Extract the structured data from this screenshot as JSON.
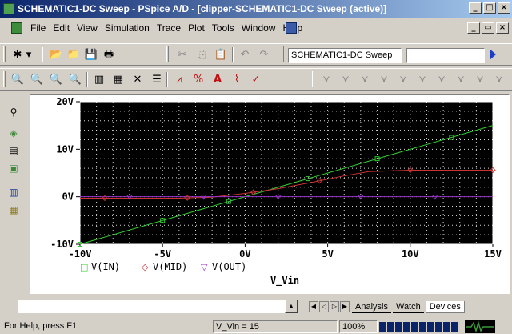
{
  "window": {
    "title": "SCHEMATIC1-DC Sweep - PSpice A/D - [clipper-SCHEMATIC1-DC Sweep (active)]",
    "min_glyph": "_",
    "max_glyph": "□",
    "close_glyph": "×",
    "restore_glyph": "▭"
  },
  "menu": {
    "items": [
      "File",
      "Edit",
      "View",
      "Simulation",
      "Trace",
      "Plot",
      "Tools",
      "Window",
      "Help"
    ]
  },
  "toolbar1": {
    "profile_value": "SCHEMATIC1-DC Sweep",
    "search_value": ""
  },
  "icons": {
    "new": "✱",
    "dropdown": "▾",
    "open": "📂",
    "open2": "📁",
    "save": "💾",
    "print": "🖶",
    "cut": "✂",
    "copy": "⎘",
    "paste": "📋",
    "undo": "↶",
    "redo": "↷",
    "zoom_in": "🔍",
    "zoom_out": "🔍",
    "zoom_area": "🔍",
    "zoom_fit": "🔍",
    "log_x": "▥",
    "fourier": "▦",
    "performance": "✕",
    "toggle": "☰",
    "add_trace": "⩘",
    "trace_math": "%",
    "ab": "A",
    "cursor": "⌇",
    "cursor2": "✓",
    "mark": "⋎",
    "dock1": "⚲",
    "dock2": "◈",
    "dock3": "▤",
    "dock4": "▣",
    "dock5": "▥",
    "dock6": "▦",
    "out_up": "▲",
    "out_down": "▼",
    "tab_first": "◀",
    "tab_prev": "◁",
    "tab_next": "▷",
    "tab_last": "▶"
  },
  "plot": {
    "background": "#000000",
    "grid_color": "#ffffff",
    "x_label": "V_Vin",
    "legend": [
      {
        "marker": "□",
        "label": "V(IN)",
        "color": "#33cc33"
      },
      {
        "marker": "◇",
        "label": "V(MID)",
        "color": "#cc3333"
      },
      {
        "marker": "▽",
        "label": "V(OUT)",
        "color": "#9933cc"
      }
    ]
  },
  "chart_data": {
    "type": "line",
    "x_ticks": [
      "-10V",
      "-5V",
      "0V",
      "5V",
      "10V",
      "15V"
    ],
    "y_ticks": [
      "20V",
      "10V",
      "0V",
      "-10V"
    ],
    "xlabel": "V_Vin",
    "xlim": [
      -10,
      15
    ],
    "ylim": [
      -10,
      20
    ],
    "series": [
      {
        "name": "V(IN)",
        "color": "#33cc33",
        "x": [
          -10,
          15
        ],
        "y": [
          -10,
          15
        ]
      },
      {
        "name": "V(MID)",
        "color": "#cc3333",
        "x": [
          -10,
          -4,
          -2,
          0,
          2,
          4,
          6,
          7.5,
          10,
          15
        ],
        "y": [
          -0.3,
          -0.3,
          -0.1,
          0.7,
          1.7,
          3.0,
          4.4,
          5.3,
          5.6,
          5.6
        ]
      },
      {
        "name": "V(OUT)",
        "color": "#9933cc",
        "x": [
          -10,
          -3,
          0,
          15
        ],
        "y": [
          0,
          0,
          0,
          0
        ]
      }
    ],
    "grid": true
  },
  "output": {
    "tabs": [
      "Analysis",
      "Watch",
      "Devices"
    ],
    "active_tab": "Devices"
  },
  "status": {
    "help": "For Help, press F1",
    "coord": "V_Vin = 15",
    "zoom": "100%"
  }
}
